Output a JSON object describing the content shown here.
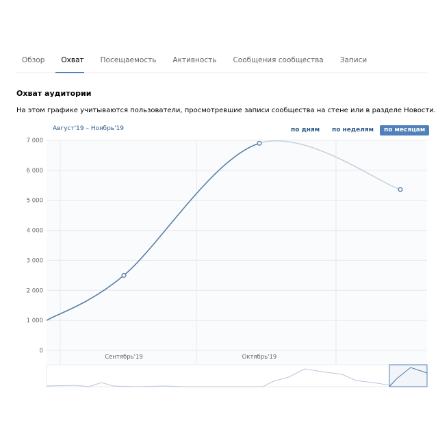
{
  "tabs": [
    {
      "label": "Обзор",
      "active": false
    },
    {
      "label": "Охват",
      "active": true
    },
    {
      "label": "Посещаемость",
      "active": false
    },
    {
      "label": "Активность",
      "active": false
    },
    {
      "label": "Сообщения сообщества",
      "active": false
    },
    {
      "label": "Записи",
      "active": false
    }
  ],
  "section": {
    "title": "Охват аудитории",
    "description": "На этом графике учитываются пользователи, просмотревшие записи сообщества на стене или в разделе Новости."
  },
  "period": "Август'19 – Ноябрь'19",
  "switches": {
    "days": "по дням",
    "weeks": "по неделям",
    "months": "по месяцам",
    "active": "months"
  },
  "colors": {
    "line": "#5a7fa6",
    "projection": "#c8d3de",
    "accent": "#5181b8",
    "link": "#2a5885"
  },
  "chart_data": {
    "type": "line",
    "x": [
      "Август'19",
      "Сентябрь'19",
      "Октябрь'19",
      "Ноябрь'19"
    ],
    "x_tick_labels": [
      "Сентябрь'19",
      "Октябрь'19"
    ],
    "series": [
      {
        "values": [
          1000,
          2500,
          6900,
          5360
        ]
      }
    ],
    "projected_from_index": 2,
    "y_ticks": [
      "0",
      "1 000",
      "2 000",
      "3 000",
      "4 000",
      "5 000",
      "6 000",
      "7 000"
    ],
    "ylim": [
      0,
      7000
    ],
    "grid": true,
    "navigator": true
  }
}
